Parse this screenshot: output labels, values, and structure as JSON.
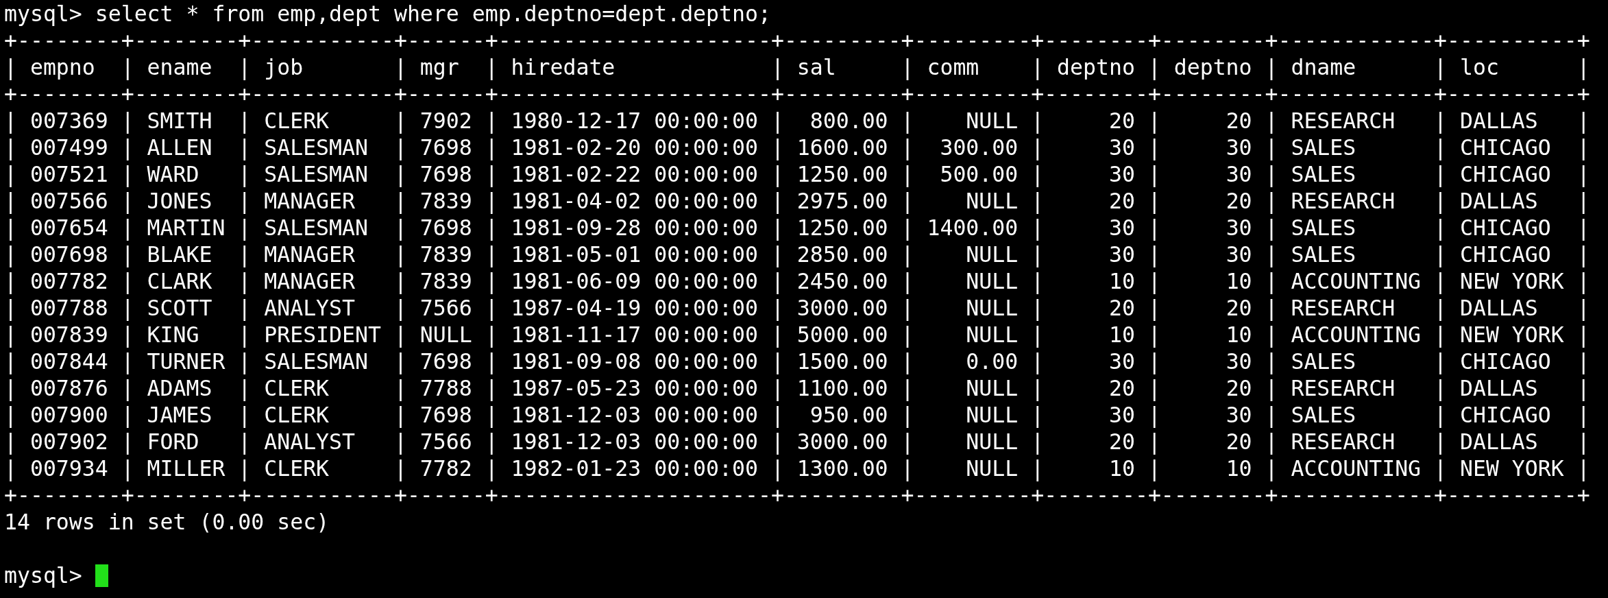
{
  "command_line": {
    "prompt": "mysql>",
    "command": "select * from emp,dept where emp.deptno=dept.deptno;"
  },
  "result_table": {
    "top_border": "+--------+--------+-----------+------+---------------------+---------+---------+--------+--------+------------+----------+",
    "header_border": "+--------+--------+-----------+------+---------------------+---------+---------+--------+--------+------------+----------+",
    "bottom_border": "+--------+--------+-----------+------+---------------------+---------+---------+--------+--------+------------+----------+",
    "column_separator": "|",
    "columns": [
      {
        "label": "empno"
      },
      {
        "label": "ename",
        "numeric": false
      },
      {
        "label": "job",
        "numeric": false
      },
      {
        "label": "mgr"
      },
      {
        "label": "hiredate"
      },
      {
        "label": "sal",
        "numeric": true
      },
      {
        "label": "comm",
        "numeric": true
      },
      {
        "label": "deptno",
        "numeric": true
      },
      {
        "label": "deptno",
        "numeric": true
      },
      {
        "label": "dname",
        "numeric": false
      },
      {
        "label": "loc",
        "numeric": false
      }
    ],
    "rows": [
      [
        "007369",
        "SMITH",
        "CLERK",
        "7902",
        "1980-12-17 00:00:00",
        "800.00",
        "NULL",
        "20",
        "20",
        "RESEARCH",
        "DALLAS"
      ],
      [
        "007499",
        "ALLEN",
        "SALESMAN",
        "7698",
        "1981-02-20 00:00:00",
        "1600.00",
        "300.00",
        "30",
        "30",
        "SALES",
        "CHICAGO"
      ],
      [
        "007521",
        "WARD",
        "SALESMAN",
        "7698",
        "1981-02-22 00:00:00",
        "1250.00",
        "500.00",
        "30",
        "30",
        "SALES",
        "CHICAGO"
      ],
      [
        "007566",
        "JONES",
        "MANAGER",
        "7839",
        "1981-04-02 00:00:00",
        "2975.00",
        "NULL",
        "20",
        "20",
        "RESEARCH",
        "DALLAS"
      ],
      [
        "007654",
        "MARTIN",
        "SALESMAN",
        "7698",
        "1981-09-28 00:00:00",
        "1250.00",
        "1400.00",
        "30",
        "30",
        "SALES",
        "CHICAGO"
      ],
      [
        "007698",
        "BLAKE",
        "MANAGER",
        "7839",
        "1981-05-01 00:00:00",
        "2850.00",
        "NULL",
        "30",
        "30",
        "SALES",
        "CHICAGO"
      ],
      [
        "007782",
        "CLARK",
        "MANAGER",
        "7839",
        "1981-06-09 00:00:00",
        "2450.00",
        "NULL",
        "10",
        "10",
        "ACCOUNTING",
        "NEW YORK"
      ],
      [
        "007788",
        "SCOTT",
        "ANALYST",
        "7566",
        "1987-04-19 00:00:00",
        "3000.00",
        "NULL",
        "20",
        "20",
        "RESEARCH",
        "DALLAS"
      ],
      [
        "007839",
        "KING",
        "PRESIDENT",
        "NULL",
        "1981-11-17 00:00:00",
        "5000.00",
        "NULL",
        "10",
        "10",
        "ACCOUNTING",
        "NEW YORK"
      ],
      [
        "007844",
        "TURNER",
        "SALESMAN",
        "7698",
        "1981-09-08 00:00:00",
        "1500.00",
        "0.00",
        "30",
        "30",
        "SALES",
        "CHICAGO"
      ],
      [
        "007876",
        "ADAMS",
        "CLERK",
        "7788",
        "1987-05-23 00:00:00",
        "1100.00",
        "NULL",
        "20",
        "20",
        "RESEARCH",
        "DALLAS"
      ],
      [
        "007900",
        "JAMES",
        "CLERK",
        "7698",
        "1981-12-03 00:00:00",
        "950.00",
        "NULL",
        "30",
        "30",
        "SALES",
        "CHICAGO"
      ],
      [
        "007902",
        "FORD",
        "ANALYST",
        "7566",
        "1981-12-03 00:00:00",
        "3000.00",
        "NULL",
        "20",
        "20",
        "RESEARCH",
        "DALLAS"
      ],
      [
        "007934",
        "MILLER",
        "CLERK",
        "7782",
        "1982-01-23 00:00:00",
        "1300.00",
        "NULL",
        "10",
        "10",
        "ACCOUNTING",
        "NEW YORK"
      ]
    ]
  },
  "summary": "14 rows in set (0.00 sec)",
  "input_line": {
    "prompt": "mysql>",
    "cursor_visible": true
  }
}
